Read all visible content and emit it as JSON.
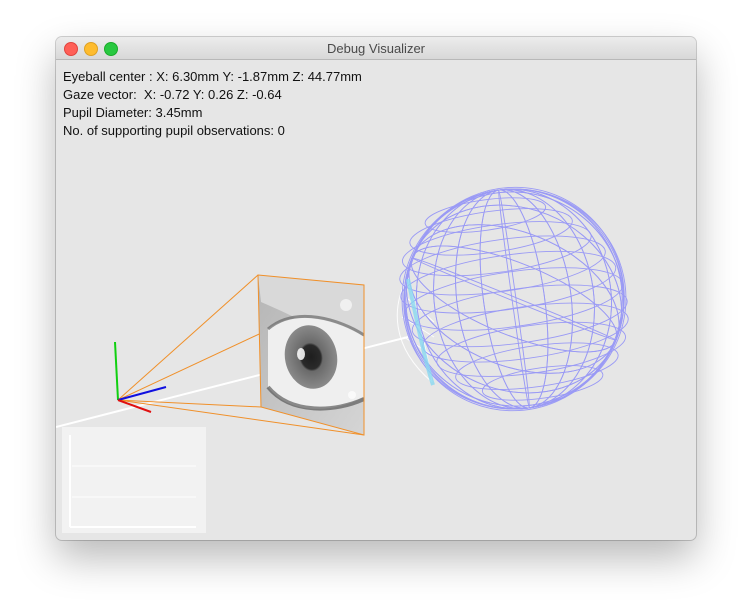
{
  "window": {
    "title": "Debug Visualizer"
  },
  "info": {
    "eyeball_center": "Eyeball center : X: 6.30mm Y: -1.87mm Z: 44.77mm",
    "gaze_vector": "Gaze vector:  X: -0.72 Y: 0.26 Z: -0.64",
    "pupil_diameter": "Pupil Diameter: 3.45mm",
    "supporting_observations": "No. of supporting pupil observations: 0"
  },
  "colors": {
    "frustum": "#f0902a",
    "sphere_wire": "#9a9af5",
    "gaze_line": "#ffffff",
    "axis_x": "#e01010",
    "axis_y": "#10d010",
    "axis_z": "#1010e0",
    "pupil_band": "#8ad8f0"
  },
  "icons": {
    "close": "close-traffic-light-icon",
    "minimize": "minimize-traffic-light-icon",
    "maximize": "maximize-traffic-light-icon"
  }
}
